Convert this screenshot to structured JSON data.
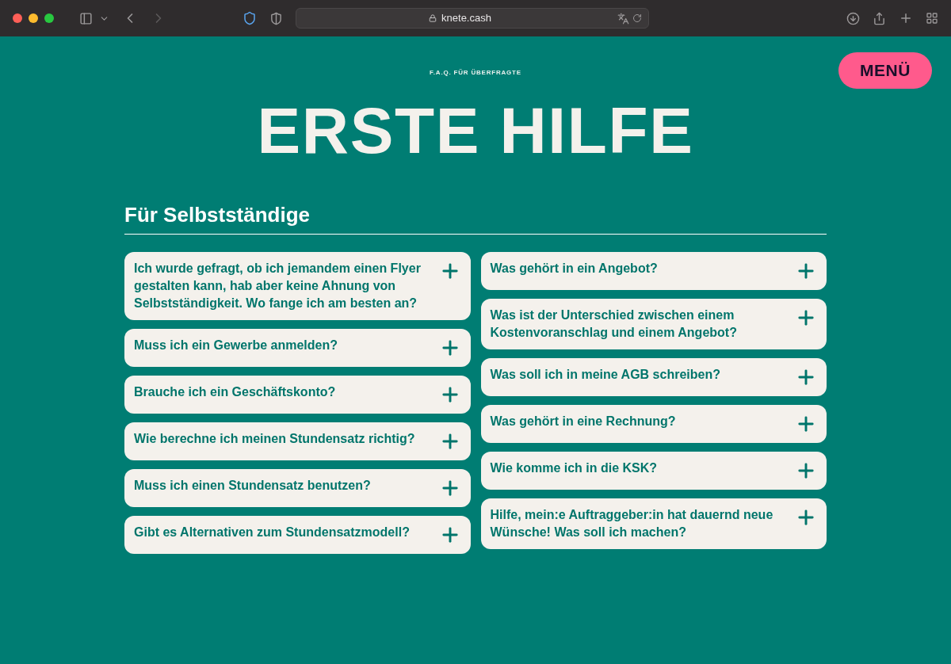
{
  "browser": {
    "url": "knete.cash"
  },
  "header": {
    "eyebrow": "F.A.Q. FÜR ÜBERFRAGTE",
    "menu_button": "MENÜ",
    "title": "ERSTE HILFE"
  },
  "section": {
    "heading": "Für Selbstständige",
    "columns": [
      [
        {
          "question": "Ich wurde gefragt, ob ich jemandem einen Flyer gestalten kann, hab aber keine Ahnung von Selbstständigkeit. Wo fange ich am besten an?",
          "expanded": false
        },
        {
          "question": "Muss ich ein Gewerbe anmelden?",
          "expanded": false
        },
        {
          "question": "Brauche ich ein Geschäftskonto?",
          "expanded": false
        },
        {
          "question": "Wie berechne ich meinen Stundensatz richtig?",
          "expanded": false
        },
        {
          "question": "Muss ich einen Stundensatz benutzen?",
          "expanded": false
        },
        {
          "question": "Gibt es Alternativen zum Stundensatzmodell?",
          "expanded": false
        }
      ],
      [
        {
          "question": "Was gehört in ein Angebot?",
          "expanded": false
        },
        {
          "question": "Was ist der Unterschied zwischen einem Kostenvoranschlag und einem Angebot?",
          "expanded": false
        },
        {
          "question": "Was soll ich in meine AGB schreiben?",
          "expanded": false
        },
        {
          "question": "Was gehört in eine Rechnung?",
          "expanded": false
        },
        {
          "question": "Wie komme ich in die KSK?",
          "expanded": false
        },
        {
          "question": "Hilfe, mein:e Auftraggeber:in hat dauernd neue Wünsche! Was soll ich machen?",
          "expanded": false
        }
      ]
    ]
  }
}
